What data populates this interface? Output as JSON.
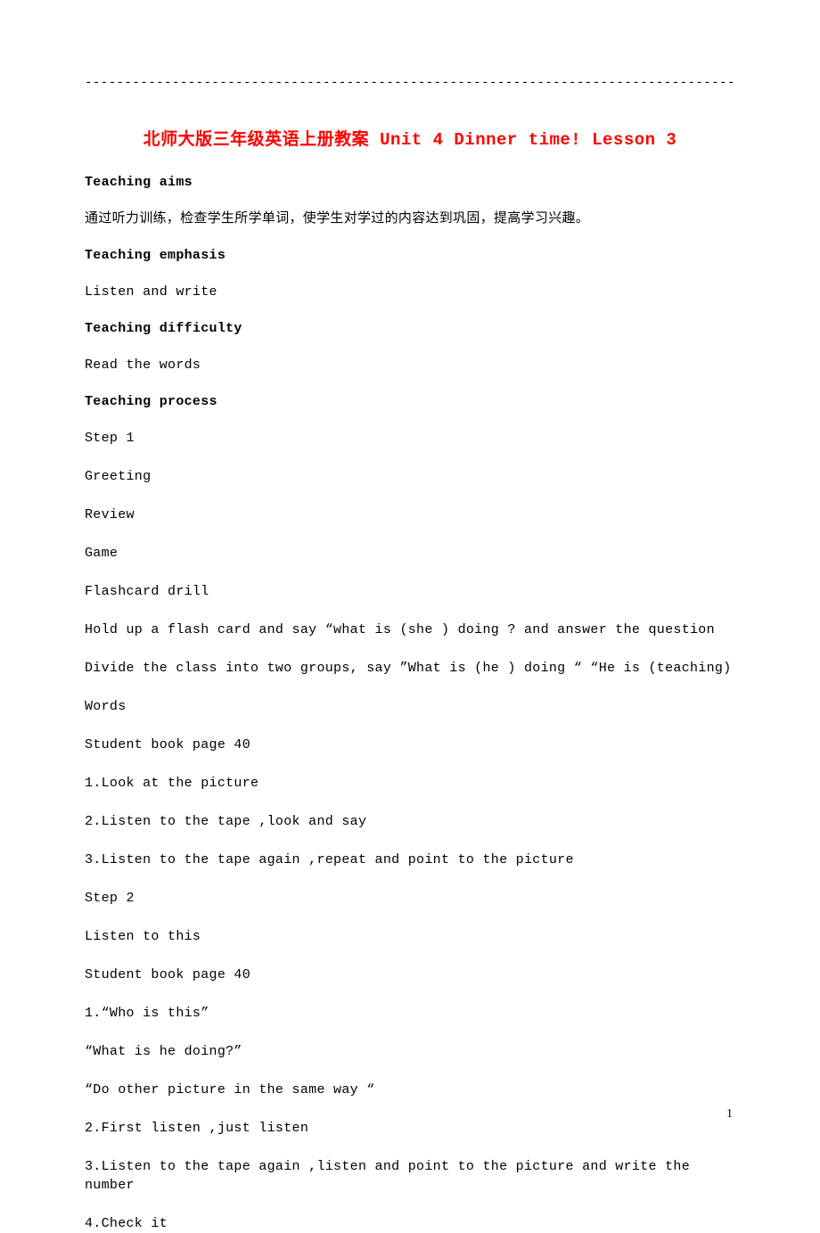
{
  "rule": "------------------------------------------------------------------------------------------",
  "title": "北师大版三年级英语上册教案 Unit 4 Dinner time! Lesson 3",
  "sections": {
    "aims_heading": "Teaching aims",
    "aims_text": "通过听力训练，检查学生所学单词，使学生对学过的内容达到巩固，提高学习兴趣。",
    "emphasis_heading": "Teaching emphasis",
    "emphasis_text": "Listen and write",
    "difficulty_heading": "Teaching difficulty",
    "difficulty_text": "Read the words",
    "process_heading": "Teaching process"
  },
  "process_lines": [
    "Step 1",
    "Greeting",
    "Review",
    "Game",
    "Flashcard drill",
    "Hold up a flash card and say “what is (she ) doing ? and answer the question",
    "Divide the class into two groups, say ”What is (he ) doing “ “He is (teaching)",
    "Words",
    "Student book page 40",
    "1.Look at the picture",
    "2.Listen to the tape ,look and say",
    "3.Listen to the tape again ,repeat and point to the picture",
    "Step 2",
    "Listen to this",
    "Student book page 40",
    "1.“Who is this”",
    "“What is he doing?”",
    "“Do other picture in the same way “",
    "2.First listen ,just listen",
    "3.Listen to the tape again ,listen and point to the picture and write the number",
    "4.Check it"
  ],
  "page_number": "1"
}
